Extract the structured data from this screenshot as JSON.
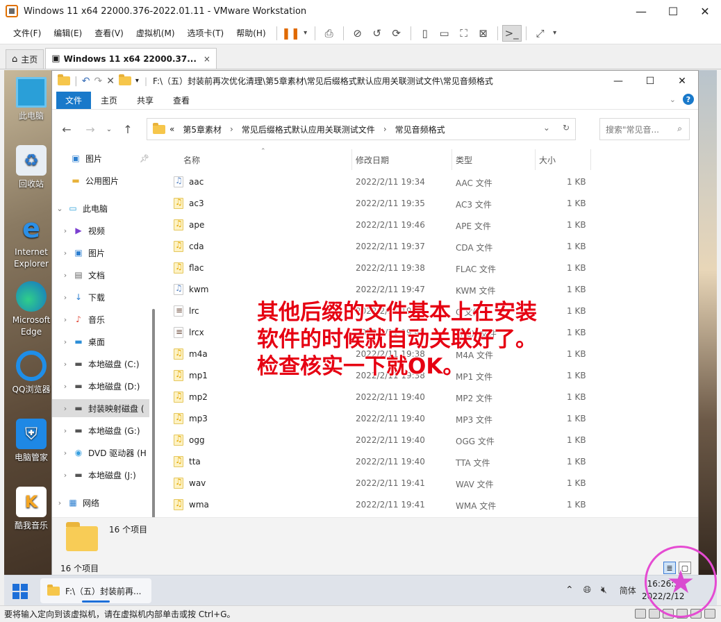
{
  "vmware": {
    "title": "Windows 11 x64 22000.376-2022.01.11 - VMware Workstation",
    "menu": [
      "文件(F)",
      "编辑(E)",
      "查看(V)",
      "虚拟机(M)",
      "选项卡(T)",
      "帮助(H)"
    ],
    "tabs": [
      {
        "label": "主页"
      },
      {
        "label": "Windows 11 x64 22000.37...",
        "close": "×"
      }
    ],
    "status_text": "要将输入定向到该虚拟机，请在虚拟机内部单击或按 Ctrl+G。"
  },
  "desktop": {
    "icons": [
      {
        "label": "此电脑",
        "icon": "monitor-icon"
      },
      {
        "label": "回收站",
        "icon": "recycle-bin-icon"
      },
      {
        "label": "Internet Explorer",
        "icon": "ie-icon"
      },
      {
        "label": "Microsoft Edge",
        "icon": "edge-icon"
      },
      {
        "label": "QQ浏览器",
        "icon": "qq-browser-icon"
      },
      {
        "label": "电脑管家",
        "icon": "pc-manager-icon"
      },
      {
        "label": "酷我音乐",
        "icon": "kuwo-music-icon"
      }
    ]
  },
  "explorer": {
    "title_path": "F:\\（五）封装前再次优化清理\\第5章素材\\常见后缀格式默认应用关联测试文件\\常见音频格式",
    "ribbon_tabs": [
      "文件",
      "主页",
      "共享",
      "查看"
    ],
    "address": {
      "prefix": "«",
      "crumbs": [
        "第5章素材",
        "常见后缀格式默认应用关联测试文件",
        "常见音频格式"
      ],
      "separator": "›"
    },
    "search_placeholder": "搜索\"常见音...",
    "nav_tree": [
      {
        "label": "图片",
        "icon": "pictures-icon",
        "pinned": true
      },
      {
        "label": "公用图片",
        "icon": "folder-icon"
      },
      {
        "label": "此电脑",
        "icon": "pc-icon",
        "expanded": true
      },
      {
        "label": "视频",
        "icon": "video-icon"
      },
      {
        "label": "图片",
        "icon": "pictures-icon"
      },
      {
        "label": "文档",
        "icon": "documents-icon"
      },
      {
        "label": "下载",
        "icon": "download-icon"
      },
      {
        "label": "音乐",
        "icon": "music-icon"
      },
      {
        "label": "桌面",
        "icon": "desktop-icon"
      },
      {
        "label": "本地磁盘 (C:)",
        "icon": "drive-icon"
      },
      {
        "label": "本地磁盘 (D:)",
        "icon": "drive-icon"
      },
      {
        "label": "封装映射磁盘 (",
        "icon": "drive-icon",
        "selected": true
      },
      {
        "label": "本地磁盘 (G:)",
        "icon": "drive-icon"
      },
      {
        "label": "DVD 驱动器 (H",
        "icon": "dvd-icon"
      },
      {
        "label": "本地磁盘 (J:)",
        "icon": "drive-icon"
      },
      {
        "label": "网络",
        "icon": "network-icon"
      }
    ],
    "columns": [
      "名称",
      "修改日期",
      "类型",
      "大小"
    ],
    "files": [
      {
        "name": "aac",
        "date": "2022/2/11 19:34",
        "type": "AAC 文件",
        "size": "1 KB",
        "icon": "blue"
      },
      {
        "name": "ac3",
        "date": "2022/2/11 19:35",
        "type": "AC3 文件",
        "size": "1 KB",
        "icon": "yellow"
      },
      {
        "name": "ape",
        "date": "2022/2/11 19:46",
        "type": "APE 文件",
        "size": "1 KB",
        "icon": "yellow"
      },
      {
        "name": "cda",
        "date": "2022/2/11 19:37",
        "type": "CDA 文件",
        "size": "1 KB",
        "icon": "yellow"
      },
      {
        "name": "flac",
        "date": "2022/2/11 19:38",
        "type": "FLAC 文件",
        "size": "1 KB",
        "icon": "yellow"
      },
      {
        "name": "kwm",
        "date": "2022/2/11 19:47",
        "type": "KWM 文件",
        "size": "1 KB",
        "icon": "blue"
      },
      {
        "name": "lrc",
        "date": "2022/2/11 19:4",
        "type": "C 文件",
        "size": "1 KB",
        "icon": "lrc"
      },
      {
        "name": "lrcx",
        "date": "2022/2/11 19:48",
        "type": "LRCX 文件",
        "size": "1 KB",
        "icon": "lrc"
      },
      {
        "name": "m4a",
        "date": "2022/2/11 19:38",
        "type": "M4A 文件",
        "size": "1 KB",
        "icon": "yellow"
      },
      {
        "name": "mp1",
        "date": "2022/2/11 19:38",
        "type": "MP1 文件",
        "size": "1 KB",
        "icon": "yellow"
      },
      {
        "name": "mp2",
        "date": "2022/2/11 19:40",
        "type": "MP2 文件",
        "size": "1 KB",
        "icon": "yellow"
      },
      {
        "name": "mp3",
        "date": "2022/2/11 19:40",
        "type": "MP3 文件",
        "size": "1 KB",
        "icon": "yellow"
      },
      {
        "name": "ogg",
        "date": "2022/2/11 19:40",
        "type": "OGG 文件",
        "size": "1 KB",
        "icon": "yellow"
      },
      {
        "name": "tta",
        "date": "2022/2/11 19:40",
        "type": "TTA 文件",
        "size": "1 KB",
        "icon": "yellow"
      },
      {
        "name": "wav",
        "date": "2022/2/11 19:41",
        "type": "WAV 文件",
        "size": "1 KB",
        "icon": "yellow"
      },
      {
        "name": "wma",
        "date": "2022/2/11 19:41",
        "type": "WMA 文件",
        "size": "1 KB",
        "icon": "yellow"
      }
    ],
    "details_count": "16 个项目",
    "status_count": "16 个项目"
  },
  "overlay": {
    "color": "#e60012",
    "lines": [
      "其他后缀的文件基本上在安装",
      "软件的时候就自动关联好了。",
      "检查核实一下就OK。"
    ]
  },
  "taskbar": {
    "app_label": "F:\\（五）封装前再...",
    "ime": "简体",
    "time": "16:26:36",
    "date": "2022/2/12"
  },
  "colors": {
    "ribbon_file_tab": "#1979ca",
    "vm_pause": "#e06a00",
    "watermark": "#e54bd2"
  }
}
